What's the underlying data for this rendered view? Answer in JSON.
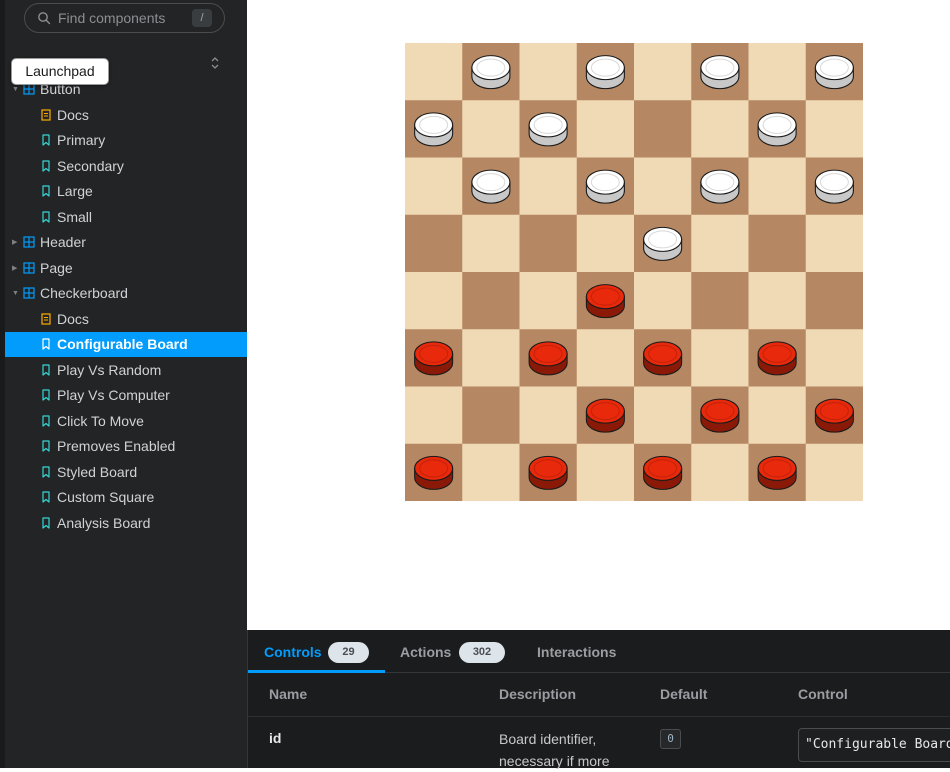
{
  "search": {
    "placeholder": "Find components",
    "shortcut": "/"
  },
  "tooltip": "Launchpad",
  "sidebar": {
    "items": [
      {
        "label": "Button",
        "kind": "component",
        "expanded": true
      },
      {
        "label": "Docs",
        "kind": "docs"
      },
      {
        "label": "Primary",
        "kind": "story"
      },
      {
        "label": "Secondary",
        "kind": "story"
      },
      {
        "label": "Large",
        "kind": "story"
      },
      {
        "label": "Small",
        "kind": "story"
      },
      {
        "label": "Header",
        "kind": "component",
        "expanded": false
      },
      {
        "label": "Page",
        "kind": "component",
        "expanded": false
      },
      {
        "label": "Checkerboard",
        "kind": "component",
        "expanded": true
      },
      {
        "label": "Docs",
        "kind": "docs"
      },
      {
        "label": "Configurable Board",
        "kind": "story",
        "selected": true
      },
      {
        "label": "Play Vs Random",
        "kind": "story"
      },
      {
        "label": "Play Vs Computer",
        "kind": "story"
      },
      {
        "label": "Click To Move",
        "kind": "story"
      },
      {
        "label": "Premoves Enabled",
        "kind": "story"
      },
      {
        "label": "Styled Board",
        "kind": "story"
      },
      {
        "label": "Custom Square",
        "kind": "story"
      },
      {
        "label": "Analysis Board",
        "kind": "story"
      }
    ]
  },
  "board": {
    "light_color": "#f0d9b5",
    "dark_color": "#b58863",
    "white_piece_color": "#ffffff",
    "red_piece_color": "#e8290b",
    "rows": [
      "-w-w-w-w",
      "w-w---w-",
      "-w-w-w-w",
      "----w---",
      "---r----",
      "r-r-r-r-",
      "---r-r-r",
      "r-r-r-r-"
    ]
  },
  "panel": {
    "tabs": [
      {
        "label": "Controls",
        "count": "29",
        "active": true
      },
      {
        "label": "Actions",
        "count": "302"
      },
      {
        "label": "Interactions"
      }
    ],
    "headers": {
      "name": "Name",
      "description": "Description",
      "default": "Default",
      "control": "Control"
    },
    "row": {
      "name": "id",
      "description": "Board identifier, necessary if more",
      "default": "0",
      "control_value": "\"Configurable Board\""
    }
  },
  "colors": {
    "accent": "#029cfd",
    "sidebar_bg": "#222425",
    "panel_bg": "#1b1c1d"
  }
}
